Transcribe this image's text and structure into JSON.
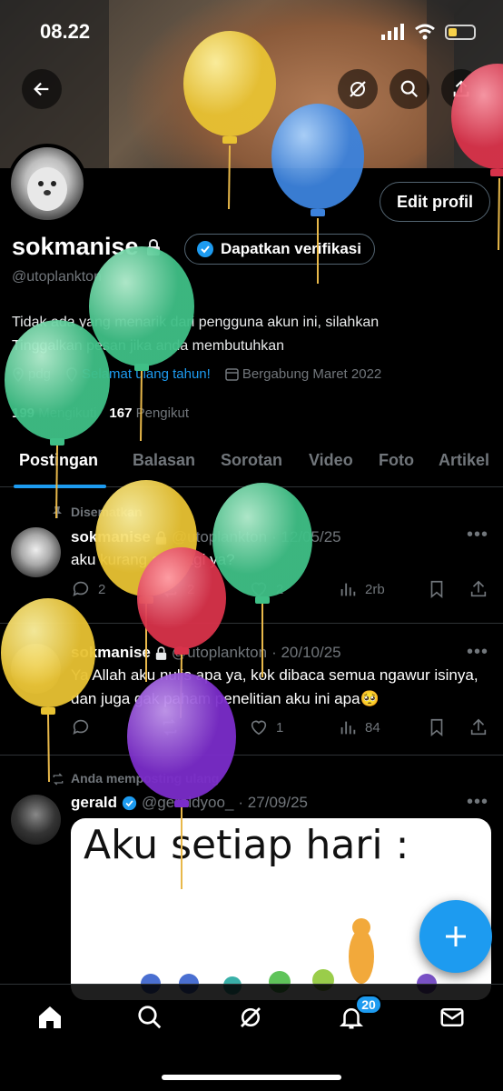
{
  "status_bar": {
    "time": "08.22"
  },
  "header": {
    "back_icon": "arrow-left-icon",
    "grok_icon": "grok-icon",
    "search_icon": "search-icon"
  },
  "profile": {
    "name": "sokmanise",
    "handle": "@utoplankton",
    "edit_label": "Edit profil",
    "verify_label": "Dapatkan verifikasi",
    "bio_line1": "Tidak ada yang menarik dari pengguna akun ini, silahkan",
    "bio_line2": "Tinggalkan pesan jika anda membutuhkan",
    "location": "pdg",
    "birthday": "Selamat ulang tahun!",
    "joined": "Bergabung Maret 2022",
    "following_count": "199",
    "following_label": "Mengikuti",
    "followers_count": "167",
    "followers_label": "Pengikut"
  },
  "tabs": [
    "Postingan",
    "Balasan",
    "Sorotan",
    "Video",
    "Foto",
    "Artikel"
  ],
  "posts": [
    {
      "context": "Disematkan",
      "name": "sokmanise",
      "handle": "@utoplankton",
      "date": "· 12/05/25",
      "text": "aku kurang apa lagi ya?",
      "replies": "2",
      "reposts": "2",
      "likes": "2",
      "views": "2rb"
    },
    {
      "name": "sokmanise",
      "handle": "@utoplankton",
      "date": "· 20/10/25",
      "text": "Ya Allah aku nulis apa ya, kok dibaca semua ngawur isinya, dan juga gak paham penelitian aku ini apa🥺",
      "replies": "",
      "reposts": "",
      "likes": "1",
      "views": "84"
    },
    {
      "context": "Anda memposting ulang",
      "name": "gerald",
      "handle": "@geraldyoo_",
      "date": "· 27/09/25",
      "media_text": "Aku setiap hari :"
    }
  ],
  "nav": {
    "notifications_badge": "20"
  },
  "colors": {
    "accent": "#1d9bf0",
    "background": "#000000",
    "muted": "#71767b"
  }
}
